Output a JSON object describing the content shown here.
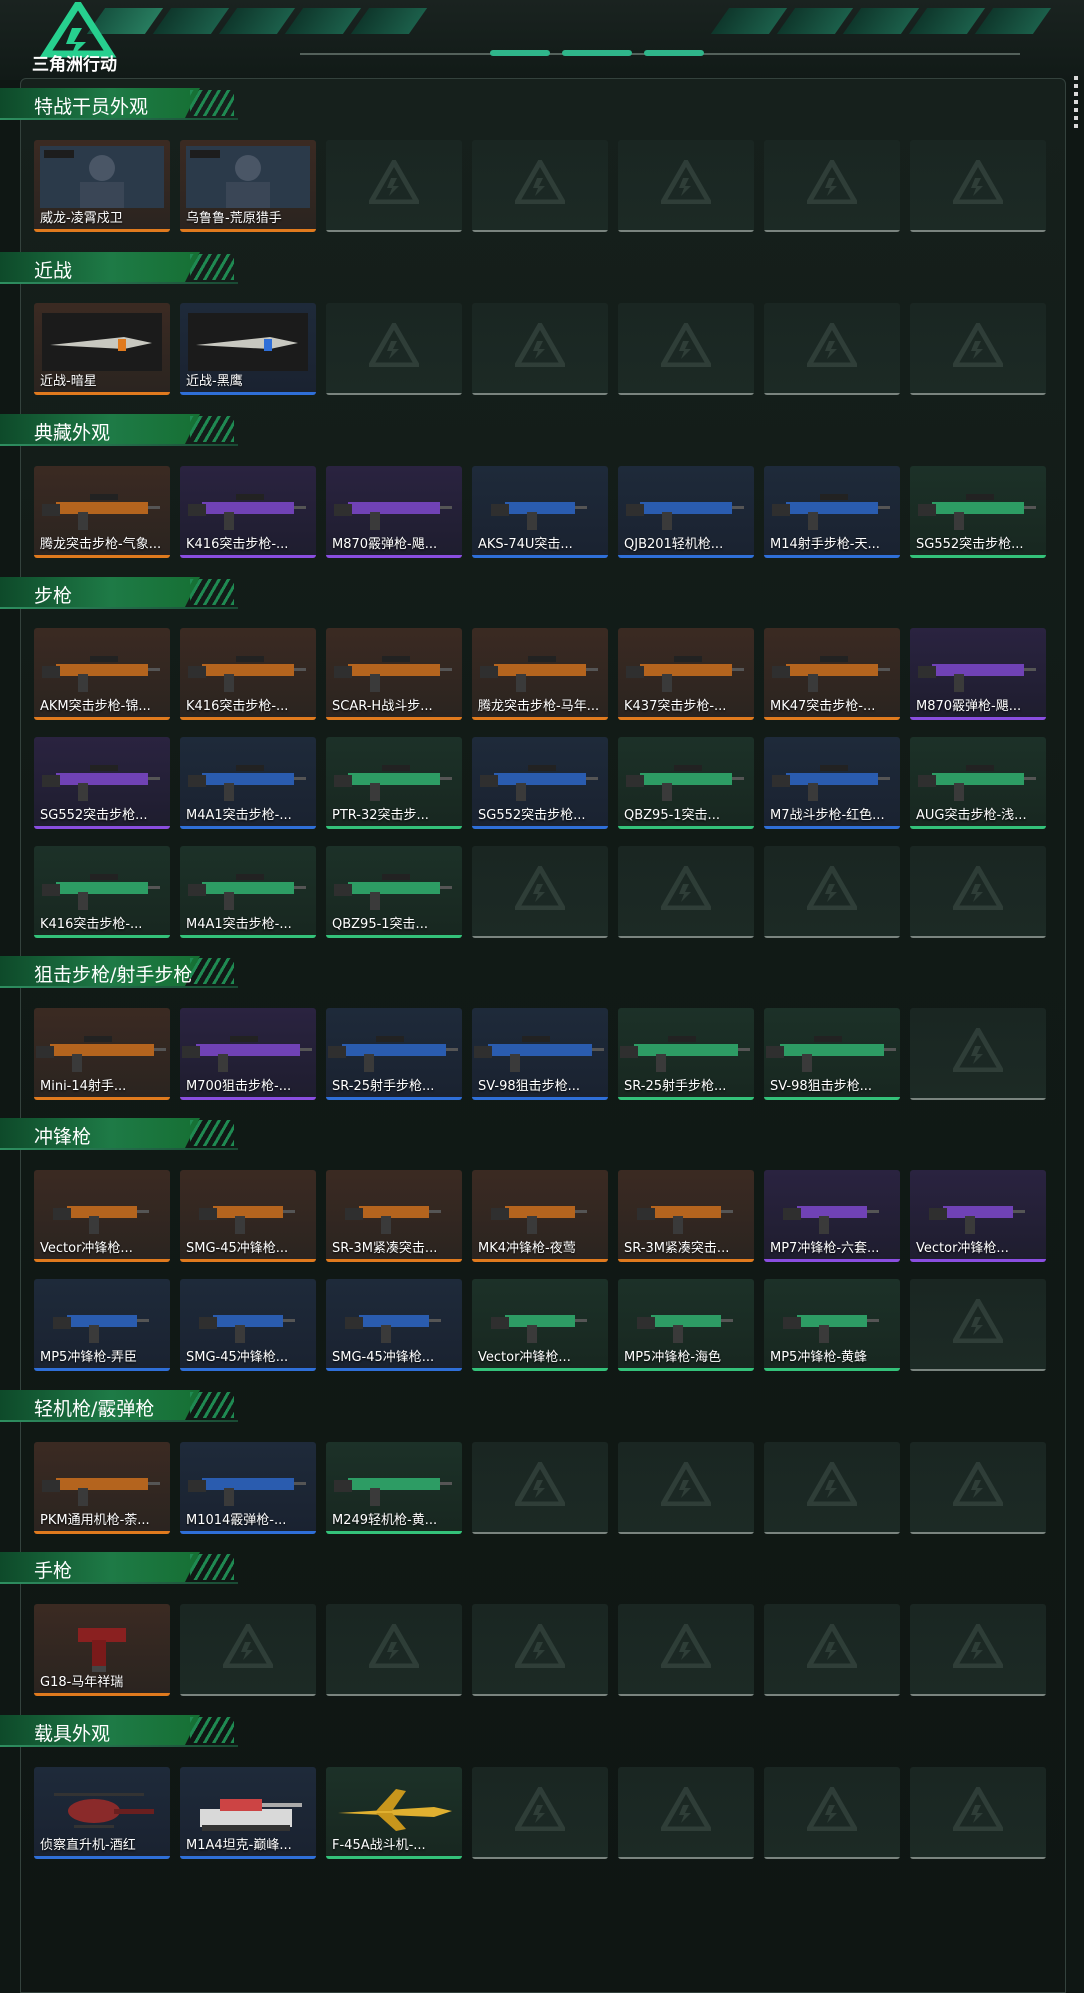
{
  "app": {
    "logo_text": "三角洲行动"
  },
  "colors": {
    "gold": "#e07a1e",
    "purple": "#8a4ee0",
    "blue": "#2f6fd8",
    "green": "#34c27a",
    "empty": "#7a847f",
    "accent": "#2fb58a"
  },
  "sections": [
    {
      "title": "特战干员外观",
      "items": [
        {
          "label": "威龙-凌霄戍卫",
          "rarity": "gold",
          "icon": "operator-portrait"
        },
        {
          "label": "乌鲁鲁-荒原猎手",
          "rarity": "gold",
          "icon": "operator-portrait"
        }
      ]
    },
    {
      "title": "近战",
      "items": [
        {
          "label": "近战-暗星",
          "rarity": "gold",
          "icon": "knife"
        },
        {
          "label": "近战-黑鹰",
          "rarity": "blue",
          "icon": "knife"
        }
      ]
    },
    {
      "title": "典藏外观",
      "items": [
        {
          "label": "腾龙突击步枪-气象...",
          "rarity": "gold",
          "icon": "rifle"
        },
        {
          "label": "K416突击步枪-...",
          "rarity": "purple",
          "icon": "rifle"
        },
        {
          "label": "M870霰弹枪-飓...",
          "rarity": "purple",
          "icon": "shotgun"
        },
        {
          "label": "AKS-74U突击...",
          "rarity": "blue",
          "icon": "smg"
        },
        {
          "label": "QJB201轻机枪...",
          "rarity": "blue",
          "icon": "lmg"
        },
        {
          "label": "M14射手步枪-天...",
          "rarity": "blue",
          "icon": "rifle"
        },
        {
          "label": "SG552突击步枪...",
          "rarity": "green",
          "icon": "rifle"
        }
      ]
    },
    {
      "title": "步枪",
      "items": [
        {
          "label": "AKM突击步枪-锦...",
          "rarity": "gold",
          "icon": "rifle"
        },
        {
          "label": "K416突击步枪-...",
          "rarity": "gold",
          "icon": "rifle"
        },
        {
          "label": "SCAR-H战斗步...",
          "rarity": "gold",
          "icon": "rifle"
        },
        {
          "label": "腾龙突击步枪-马年...",
          "rarity": "gold",
          "icon": "rifle"
        },
        {
          "label": "K437突击步枪-...",
          "rarity": "gold",
          "icon": "rifle"
        },
        {
          "label": "MK47突击步枪-...",
          "rarity": "gold",
          "icon": "rifle"
        },
        {
          "label": "M870霰弹枪-飓...",
          "rarity": "purple",
          "icon": "shotgun"
        },
        {
          "label": "SG552突击步枪...",
          "rarity": "purple",
          "icon": "rifle"
        },
        {
          "label": "M4A1突击步枪-...",
          "rarity": "blue",
          "icon": "rifle"
        },
        {
          "label": "PTR-32突击步...",
          "rarity": "green",
          "icon": "rifle"
        },
        {
          "label": "SG552突击步枪...",
          "rarity": "blue",
          "icon": "rifle"
        },
        {
          "label": "QBZ95-1突击...",
          "rarity": "green",
          "icon": "rifle"
        },
        {
          "label": "M7战斗步枪-红色...",
          "rarity": "blue",
          "icon": "rifle"
        },
        {
          "label": "AUG突击步枪-浅...",
          "rarity": "green",
          "icon": "rifle"
        },
        {
          "label": "K416突击步枪-...",
          "rarity": "green",
          "icon": "rifle"
        },
        {
          "label": "M4A1突击步枪-...",
          "rarity": "green",
          "icon": "rifle"
        },
        {
          "label": "QBZ95-1突击...",
          "rarity": "green",
          "icon": "rifle"
        }
      ]
    },
    {
      "title": "狙击步枪/射手步枪",
      "items": [
        {
          "label": "Mini-14射手...",
          "rarity": "gold",
          "icon": "sniper"
        },
        {
          "label": "M700狙击步枪-...",
          "rarity": "purple",
          "icon": "sniper"
        },
        {
          "label": "SR-25射手步枪...",
          "rarity": "blue",
          "icon": "sniper"
        },
        {
          "label": "SV-98狙击步枪...",
          "rarity": "blue",
          "icon": "sniper"
        },
        {
          "label": "SR-25射手步枪...",
          "rarity": "green",
          "icon": "sniper"
        },
        {
          "label": "SV-98狙击步枪...",
          "rarity": "green",
          "icon": "sniper"
        }
      ]
    },
    {
      "title": "冲锋枪",
      "items": [
        {
          "label": "Vector冲锋枪...",
          "rarity": "gold",
          "icon": "smg"
        },
        {
          "label": "SMG-45冲锋枪...",
          "rarity": "gold",
          "icon": "smg"
        },
        {
          "label": "SR-3M紧凑突击...",
          "rarity": "gold",
          "icon": "smg"
        },
        {
          "label": "MK4冲锋枪-夜莺",
          "rarity": "gold",
          "icon": "smg"
        },
        {
          "label": "SR-3M紧凑突击...",
          "rarity": "gold",
          "icon": "smg"
        },
        {
          "label": "MP7冲锋枪-六套...",
          "rarity": "purple",
          "icon": "smg"
        },
        {
          "label": "Vector冲锋枪...",
          "rarity": "purple",
          "icon": "smg"
        },
        {
          "label": "MP5冲锋枪-弄臣",
          "rarity": "blue",
          "icon": "smg"
        },
        {
          "label": "SMG-45冲锋枪...",
          "rarity": "blue",
          "icon": "smg"
        },
        {
          "label": "SMG-45冲锋枪...",
          "rarity": "blue",
          "icon": "smg"
        },
        {
          "label": "Vector冲锋枪...",
          "rarity": "green",
          "icon": "smg"
        },
        {
          "label": "MP5冲锋枪-海色",
          "rarity": "green",
          "icon": "smg"
        },
        {
          "label": "MP5冲锋枪-黄蜂",
          "rarity": "green",
          "icon": "smg"
        }
      ]
    },
    {
      "title": "轻机枪/霰弹枪",
      "items": [
        {
          "label": "PKM通用机枪-荼...",
          "rarity": "gold",
          "icon": "lmg"
        },
        {
          "label": "M1014霰弹枪-...",
          "rarity": "blue",
          "icon": "shotgun"
        },
        {
          "label": "M249轻机枪-黄...",
          "rarity": "green",
          "icon": "lmg"
        }
      ]
    },
    {
      "title": "手枪",
      "items": [
        {
          "label": "G18-马年祥瑞",
          "rarity": "gold",
          "icon": "pistol"
        }
      ]
    },
    {
      "title": "载具外观",
      "items": [
        {
          "label": "侦察直升机-酒红",
          "rarity": "blue",
          "icon": "helicopter"
        },
        {
          "label": "M1A4坦克-巅峰...",
          "rarity": "blue",
          "icon": "tank"
        },
        {
          "label": "F-45A战斗机-...",
          "rarity": "green",
          "icon": "jet"
        }
      ]
    }
  ]
}
